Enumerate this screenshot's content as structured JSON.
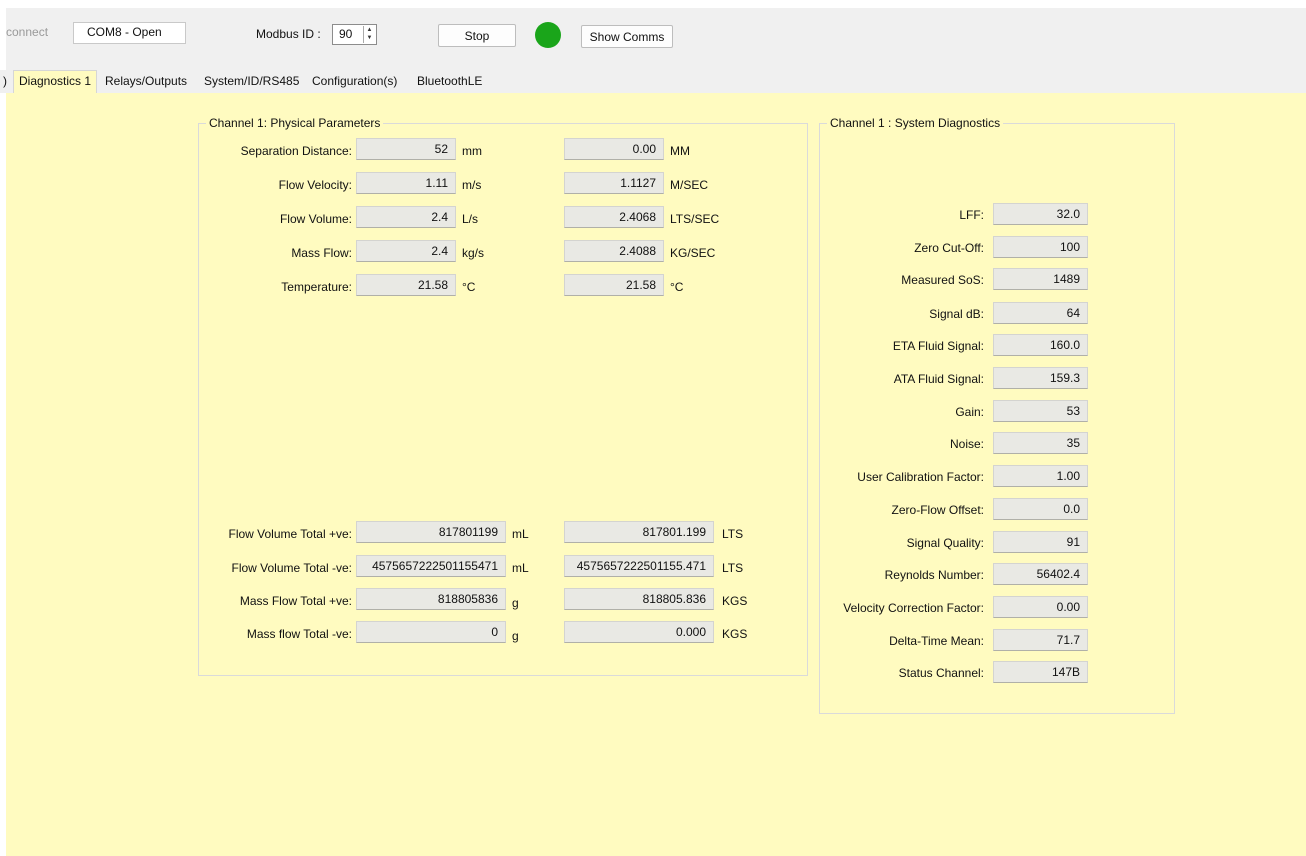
{
  "toolbar": {
    "disconnect_label": "connect",
    "port_status": "COM8 - Open",
    "modbus_label": "Modbus ID :",
    "modbus_id": "90",
    "stop_label": "Stop",
    "status_led_color": "#1aa51a",
    "show_comms_label": "Show Comms"
  },
  "tabs": {
    "prev_fragment": ")",
    "items": [
      "Diagnostics 1",
      "Relays/Outputs",
      "System/ID/RS485",
      "Configuration(s)",
      "BluetoothLE"
    ],
    "active": "Diagnostics 1"
  },
  "physical": {
    "title": "Channel 1: Physical Parameters",
    "rows": [
      {
        "label": "Separation Distance:",
        "value": "52",
        "unit": "mm",
        "value2": "0.00",
        "unit2": "MM"
      },
      {
        "label": "Flow Velocity:",
        "value": "1.11",
        "unit": "m/s",
        "value2": "1.1127",
        "unit2": "M/SEC"
      },
      {
        "label": "Flow Volume:",
        "value": "2.4",
        "unit": "L/s",
        "value2": "2.4068",
        "unit2": "LTS/SEC"
      },
      {
        "label": "Mass Flow:",
        "value": "2.4",
        "unit": "kg/s",
        "value2": "2.4088",
        "unit2": "KG/SEC"
      },
      {
        "label": "Temperature:",
        "value": "21.58",
        "unit": "°C",
        "value2": "21.58",
        "unit2": "°C"
      }
    ],
    "totals": [
      {
        "label": "Flow Volume Total +ve:",
        "value": "817801199",
        "unit": "mL",
        "value2": "817801.199",
        "unit2": "LTS"
      },
      {
        "label": "Flow Volume Total -ve:",
        "value": "4575657222501155471",
        "unit": "mL",
        "value2": "4575657222501155.471",
        "unit2": "LTS"
      },
      {
        "label": "Mass Flow Total +ve:",
        "value": "818805836",
        "unit": "g",
        "value2": "818805.836",
        "unit2": "KGS"
      },
      {
        "label": "Mass flow Total -ve:",
        "value": "0",
        "unit": "g",
        "value2": "0.000",
        "unit2": "KGS"
      }
    ]
  },
  "diagnostics": {
    "title": "Channel 1 : System Diagnostics",
    "rows": [
      {
        "label": "LFF:",
        "value": "32.0"
      },
      {
        "label": "Zero Cut-Off:",
        "value": "100"
      },
      {
        "label": "Measured SoS:",
        "value": "1489"
      },
      {
        "label": "Signal dB:",
        "value": "64"
      },
      {
        "label": "ETA Fluid Signal:",
        "value": "160.0"
      },
      {
        "label": "ATA Fluid Signal:",
        "value": "159.3"
      },
      {
        "label": "Gain:",
        "value": "53"
      },
      {
        "label": "Noise:",
        "value": "35"
      },
      {
        "label": "User Calibration Factor:",
        "value": "1.00"
      },
      {
        "label": "Zero-Flow Offset:",
        "value": "0.0"
      },
      {
        "label": "Signal Quality:",
        "value": "91"
      },
      {
        "label": "Reynolds Number:",
        "value": "56402.4"
      },
      {
        "label": "Velocity Correction Factor:",
        "value": "0.00"
      },
      {
        "label": "Delta-Time Mean:",
        "value": "71.7"
      },
      {
        "label": "Status Channel:",
        "value": "147B"
      }
    ]
  }
}
